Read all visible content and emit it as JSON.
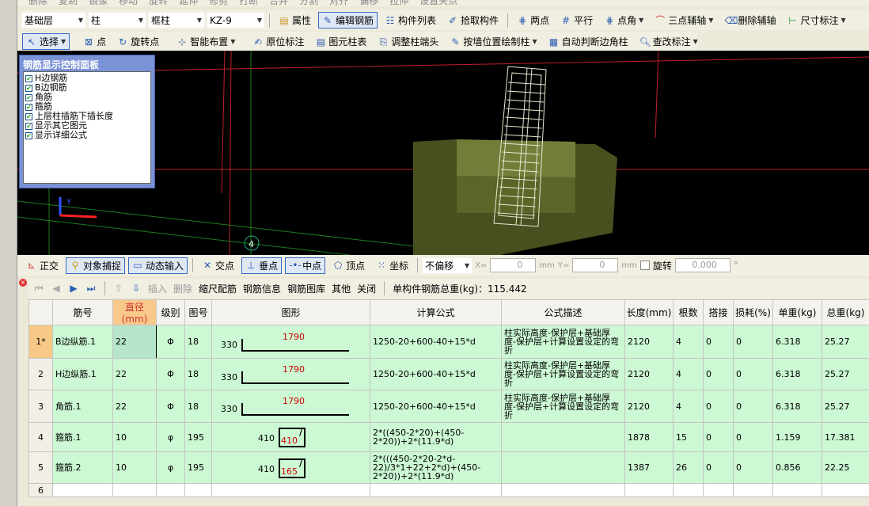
{
  "top_toolbar_cut": [
    "删除",
    "复制",
    "镜像",
    "移动",
    "旋转",
    "延伸",
    "修剪",
    "打断",
    "合并",
    "分割",
    "对齐",
    "偏移",
    "拉伸",
    "设置夹点"
  ],
  "toolbar1": {
    "floor": "基础层",
    "type": "柱",
    "subtype": "框柱",
    "component": "KZ-9",
    "buttons": [
      "属性",
      "编辑钢筋",
      "构件列表",
      "拾取构件",
      "两点",
      "平行",
      "点角",
      "三点辅轴",
      "删除辅轴",
      "尺寸标注"
    ]
  },
  "toolbar2": {
    "buttons": [
      "选择",
      "点",
      "旋转点",
      "智能布置",
      "原位标注",
      "图元柱表",
      "调整柱端头",
      "按墙位置绘制柱",
      "自动判断边角柱",
      "查改标注"
    ]
  },
  "panel": {
    "title": "钢筋显示控制面板",
    "items": [
      "H边钢筋",
      "B边钢筋",
      "角筋",
      "箍筋",
      "上层柱插筋下插长度",
      "显示其它图元",
      "显示详细公式"
    ],
    "checked": [
      true,
      true,
      true,
      true,
      true,
      true,
      true
    ]
  },
  "viewport": {
    "axis_label": "4",
    "y_axis": "Y"
  },
  "snapbar": {
    "buttons": [
      "正交",
      "对象捕捉",
      "动态输入",
      "交点",
      "垂点",
      "中点",
      "顶点",
      "坐标"
    ],
    "offset": "不偏移",
    "x_label": "X=",
    "x_value": "0",
    "y_label": "Y=",
    "y_value": "0",
    "unit": "mm",
    "rotate_label": "旋转",
    "rotate_value": "0.000",
    "degree": "°"
  },
  "gridbar": {
    "buttons": [
      "插入",
      "删除",
      "缩尺配筋",
      "钢筋信息",
      "钢筋图库",
      "其他",
      "关闭"
    ],
    "total_label": "单构件钢筋总重(kg)：115.442"
  },
  "table": {
    "headers": [
      "",
      "筋号",
      "直径(mm)",
      "级别",
      "图号",
      "图形",
      "计算公式",
      "公式描述",
      "长度(mm)",
      "根数",
      "搭接",
      "损耗(%)",
      "单重(kg)",
      "总重(kg)"
    ],
    "rows": [
      {
        "rn": "1*",
        "name": "B边纵筋.1",
        "dia": "22",
        "grade": "Φ",
        "fig": "18",
        "s1": "330",
        "s2": "1790",
        "formula": "1250-20+600-40+15*d",
        "desc": "柱实际高度-保护层+基础厚度-保护层+计算设置设定的弯折",
        "len": "2120",
        "count": "4",
        "lap": "0",
        "loss": "0",
        "unit": "6.318",
        "total": "25.27"
      },
      {
        "rn": "2",
        "name": "H边纵筋.1",
        "dia": "22",
        "grade": "Φ",
        "fig": "18",
        "s1": "330",
        "s2": "1790",
        "formula": "1250-20+600-40+15*d",
        "desc": "柱实际高度-保护层+基础厚度-保护层+计算设置设定的弯折",
        "len": "2120",
        "count": "4",
        "lap": "0",
        "loss": "0",
        "unit": "6.318",
        "total": "25.27"
      },
      {
        "rn": "3",
        "name": "角筋.1",
        "dia": "22",
        "grade": "Φ",
        "fig": "18",
        "s1": "330",
        "s2": "1790",
        "formula": "1250-20+600-40+15*d",
        "desc": "柱实际高度-保护层+基础厚度-保护层+计算设置设定的弯折",
        "len": "2120",
        "count": "4",
        "lap": "0",
        "loss": "0",
        "unit": "6.318",
        "total": "25.27"
      },
      {
        "rn": "4",
        "name": "箍筋.1",
        "dia": "10",
        "grade": "φ",
        "fig": "195",
        "s1": "410",
        "s2": "410",
        "formula": "2*((450-2*20)+(450-2*20))+2*(11.9*d)",
        "desc": "",
        "len": "1878",
        "count": "15",
        "lap": "0",
        "loss": "0",
        "unit": "1.159",
        "total": "17.381"
      },
      {
        "rn": "5",
        "name": "箍筋.2",
        "dia": "10",
        "grade": "φ",
        "fig": "195",
        "s1": "410",
        "s2": "165",
        "formula": "2*(((450-2*20-2*d-22)/3*1+22+2*d)+(450-2*20))+2*(11.9*d)",
        "desc": "",
        "len": "1387",
        "count": "26",
        "lap": "0",
        "loss": "0",
        "unit": "0.856",
        "total": "22.25"
      },
      {
        "rn": "6",
        "name": "",
        "dia": "",
        "grade": "",
        "fig": "",
        "s1": "",
        "s2": "",
        "formula": "",
        "desc": "",
        "len": "",
        "count": "",
        "lap": "",
        "loss": "",
        "unit": "",
        "total": ""
      }
    ]
  }
}
